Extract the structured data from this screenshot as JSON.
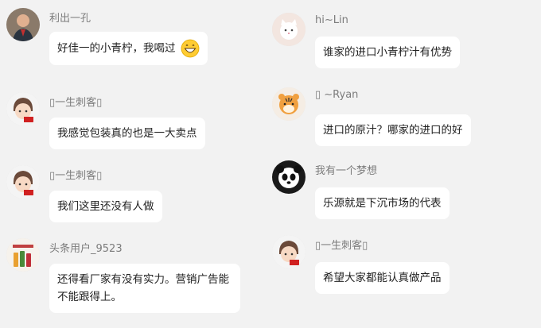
{
  "left_comments": [
    {
      "user": "利出一孔",
      "text": "好佳一的小青柠，我喝过",
      "emoji": "grinning-face-emoji",
      "avatar": "man-in-suit-avatar"
    },
    {
      "user": "▯一生刺客▯",
      "text": "我感觉包装真的也是一大卖点",
      "avatar": "cartoon-girl-avatar"
    },
    {
      "user": "▯一生刺客▯",
      "text": "我们这里还没有人做",
      "avatar": "cartoon-girl-avatar"
    },
    {
      "user": "头条用户_9523",
      "text": "还得看厂家有没有实力。营销广告能不能跟得上。",
      "avatar": "product-bottles-avatar"
    }
  ],
  "right_comments": [
    {
      "user": "hi~Lin",
      "text": "谁家的进口小青柠汁有优势",
      "avatar": "white-cat-avatar"
    },
    {
      "user": "▯ ~Ryan",
      "text": "进口的原汁？哪家的进口的好",
      "avatar": "tiger-avatar"
    },
    {
      "user": "我有一个梦想",
      "text": "乐源就是下沉市场的代表",
      "avatar": "panda-avatar"
    },
    {
      "user": "▯一生刺客▯",
      "text": "希望大家都能认真做产品",
      "avatar": "cartoon-girl-avatar"
    }
  ],
  "colors": {
    "background": "#f2f2f2",
    "bubble": "#ffffff",
    "username": "#7c7c7c",
    "text": "#222222"
  }
}
